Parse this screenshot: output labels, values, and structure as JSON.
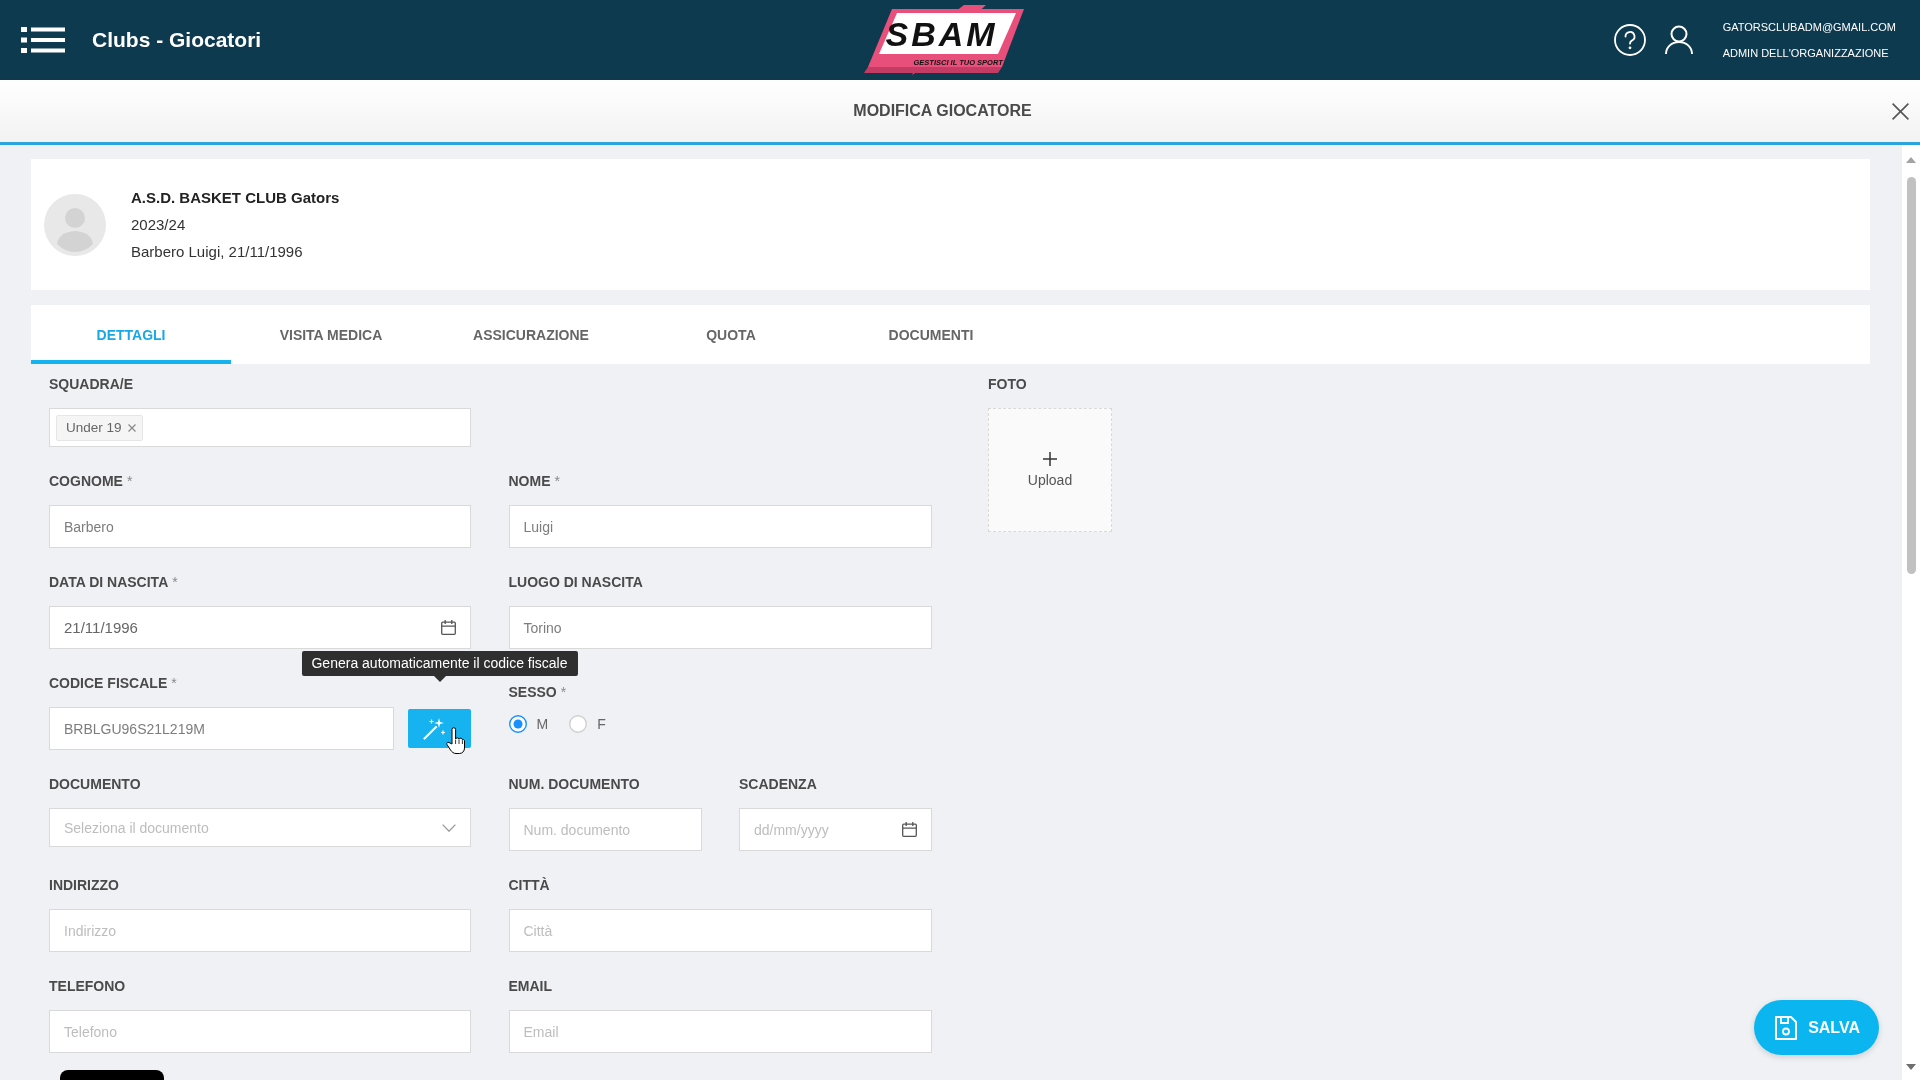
{
  "header": {
    "title": "Clubs - Giocatori",
    "logo": {
      "wordmark": "SBAM",
      "tagline": "GESTISCI IL TUO SPORT"
    },
    "user": {
      "email": "GATORSCLUBADM@GMAIL.COM",
      "role": "ADMIN DELL'ORGANIZZAZIONE"
    }
  },
  "dialog": {
    "title": "MODIFICA GIOCATORE"
  },
  "player_card": {
    "club": "A.S.D. BASKET CLUB Gators",
    "season": "2023/24",
    "player": "Barbero Luigi, 21/11/1996"
  },
  "tabs": [
    {
      "label": "DETTAGLI",
      "selected": true
    },
    {
      "label": "VISITA MEDICA",
      "selected": false
    },
    {
      "label": "ASSICURAZIONE",
      "selected": false
    },
    {
      "label": "QUOTA",
      "selected": false
    },
    {
      "label": "DOCUMENTI",
      "selected": false
    }
  ],
  "form": {
    "rows": [
      [
        {
          "kind": "tags",
          "label": "SQUADRA/E",
          "tags": [
            {
              "label": "Under 19"
            }
          ]
        }
      ],
      [
        {
          "kind": "text",
          "label": "COGNOME",
          "required_mark": "*",
          "value": "Barbero"
        },
        {
          "kind": "text",
          "label": "NOME",
          "required_mark": "*",
          "value": "Luigi"
        }
      ],
      [
        {
          "kind": "date",
          "label": "DATA DI NASCITA",
          "required_mark": "*",
          "value": "21/11/1996"
        },
        {
          "kind": "text",
          "label": "LUOGO DI NASCITA",
          "value": "Torino"
        }
      ],
      [
        {
          "kind": "generator",
          "label": "CODICE FISCALE",
          "required_mark": "*",
          "value": "BRBLGU96S21L219M",
          "tooltip": "Genera automaticamente il codice fiscale"
        },
        {
          "kind": "radio",
          "label": "SESSO",
          "required_mark": "*",
          "options": [
            {
              "label": "M",
              "selected": true
            },
            {
              "label": "F",
              "selected": false
            }
          ]
        }
      ],
      [
        {
          "kind": "select",
          "label": "DOCUMENTO",
          "placeholder": "Seleziona il documento"
        },
        {
          "kind": "text",
          "label": "NUM. DOCUMENTO",
          "placeholder": "Num. documento"
        },
        {
          "kind": "date",
          "label": "SCADENZA",
          "placeholder": "dd/mm/yyyy"
        }
      ],
      [
        {
          "kind": "text",
          "label": "INDIRIZZO",
          "placeholder": "Indirizzo"
        },
        {
          "kind": "text",
          "label": "CITTÀ",
          "placeholder": "Città"
        }
      ],
      [
        {
          "kind": "text",
          "label": "TELEFONO",
          "placeholder": "Telefono"
        },
        {
          "kind": "text",
          "label": "EMAIL",
          "placeholder": "Email"
        }
      ]
    ]
  },
  "photo": {
    "label": "FOTO",
    "upload": "Upload"
  },
  "save_button": {
    "label": "SALVA"
  }
}
